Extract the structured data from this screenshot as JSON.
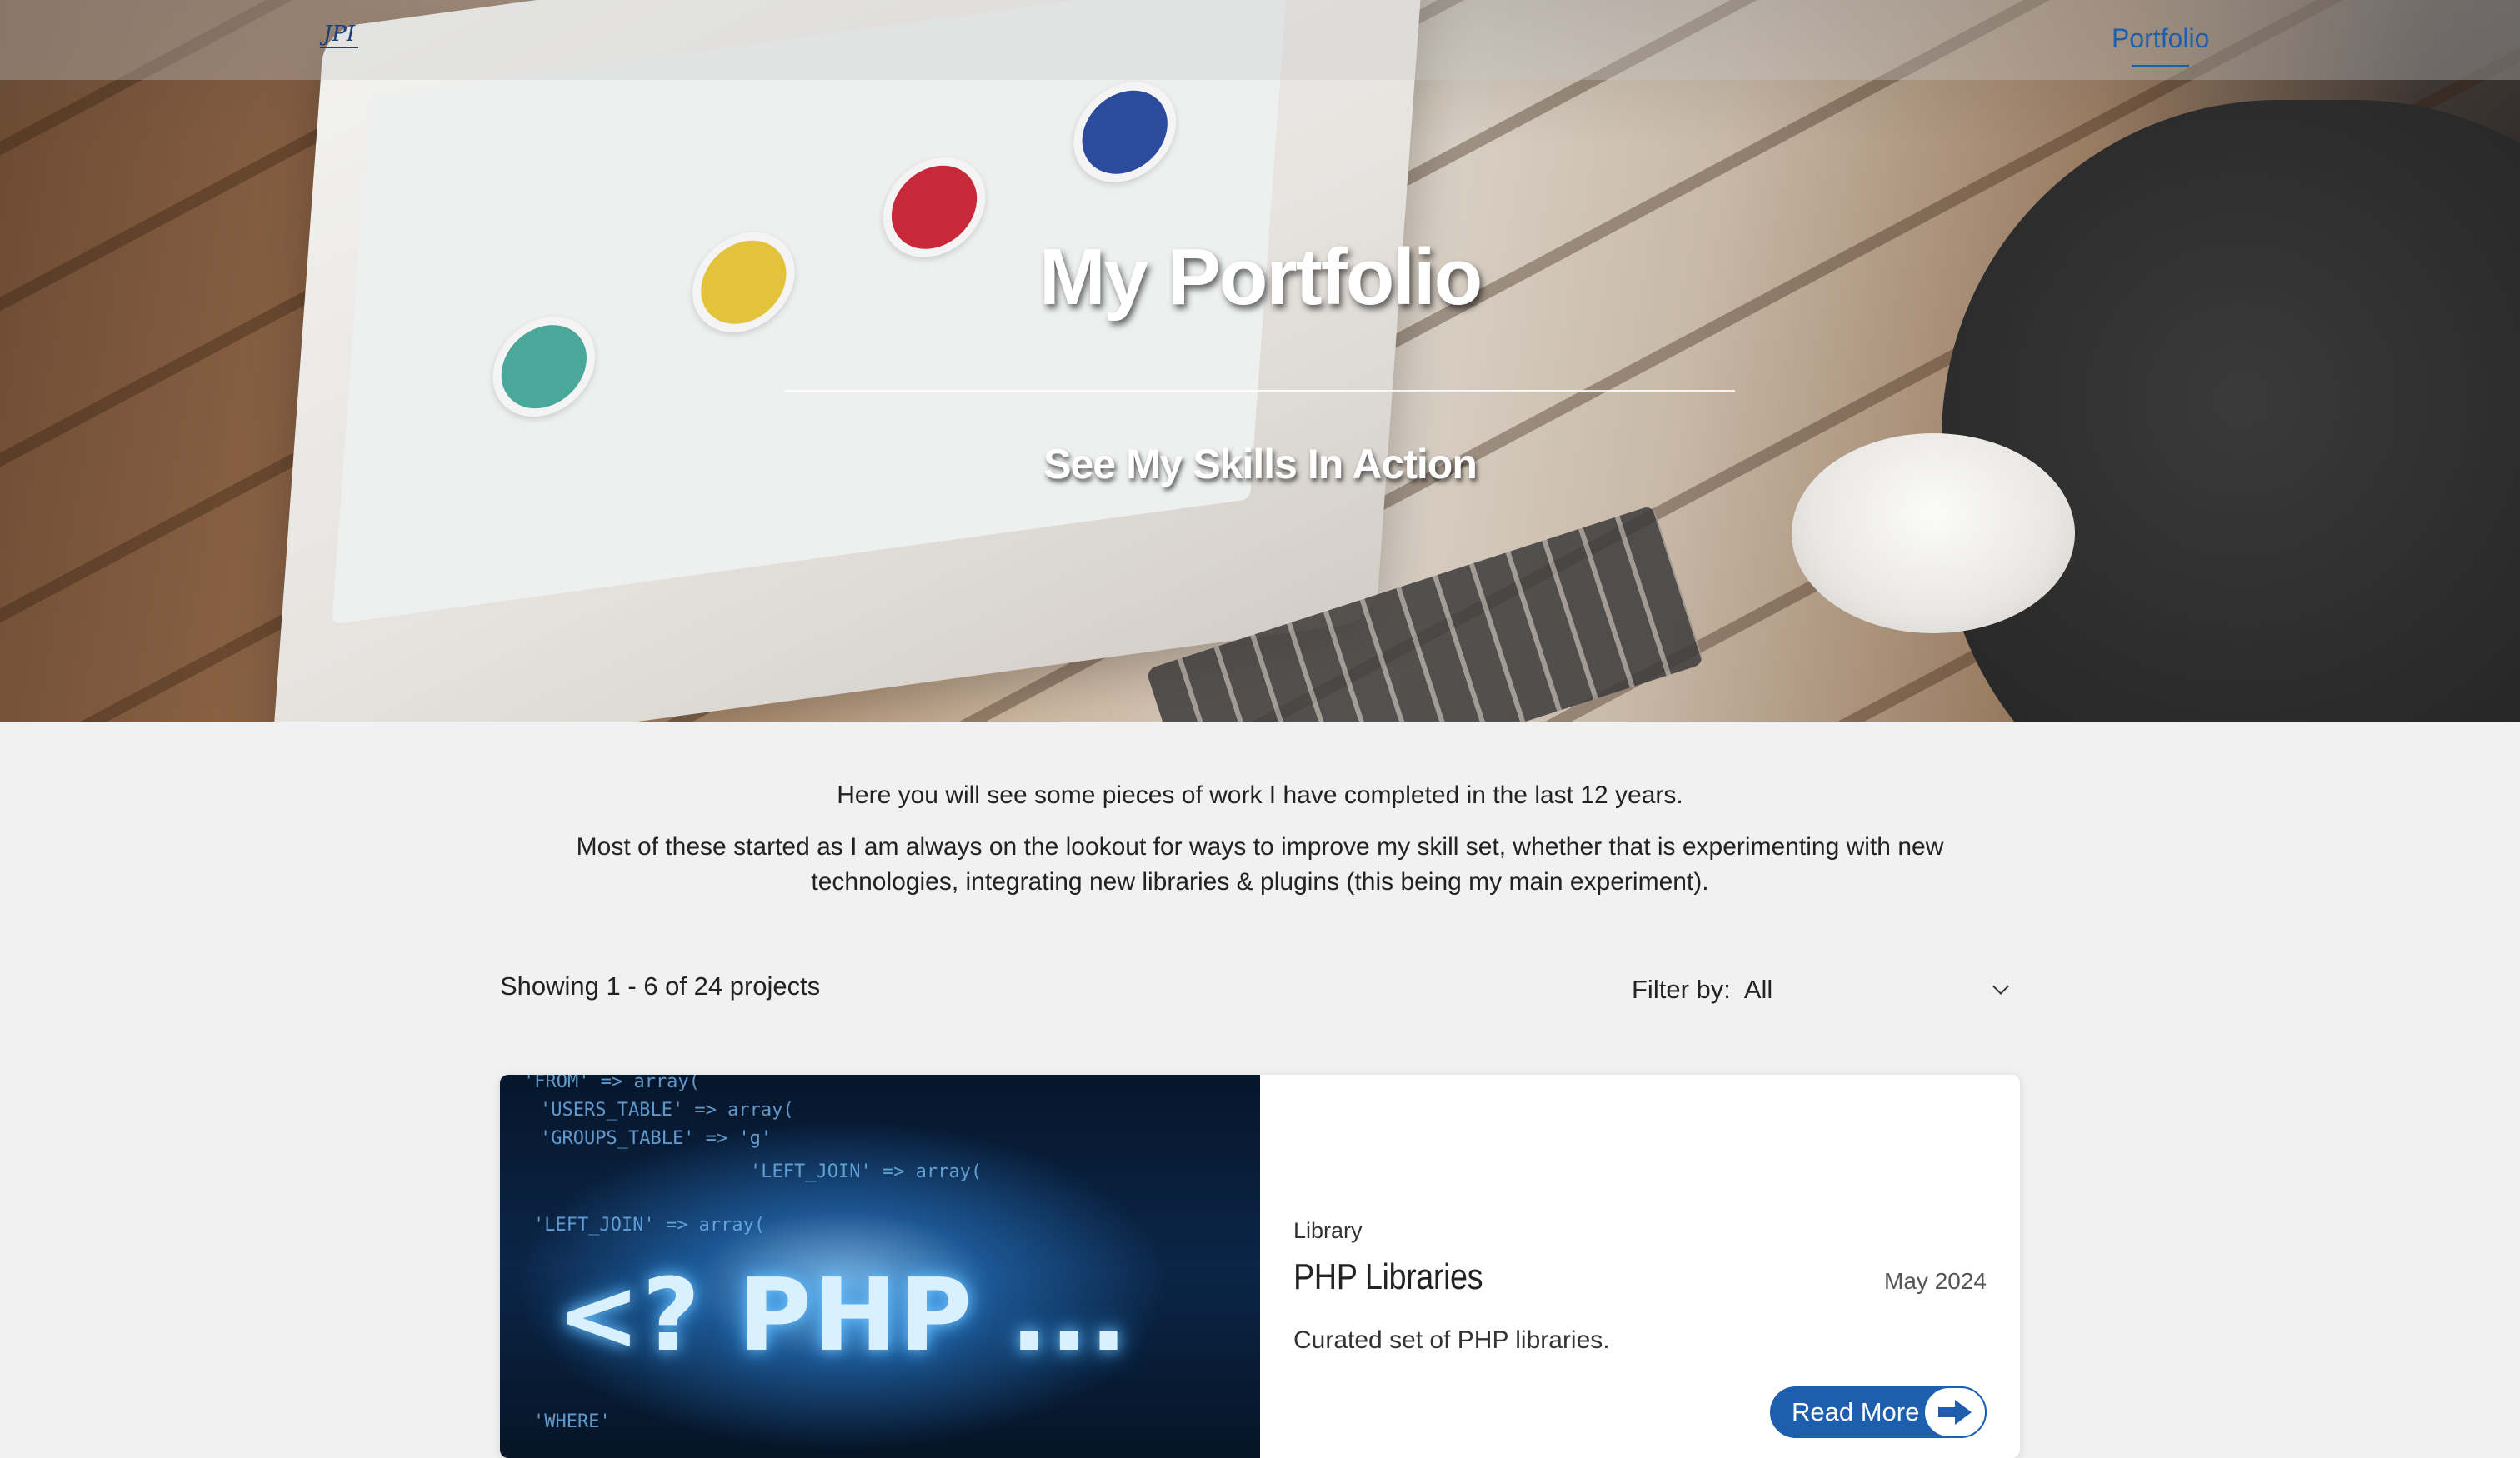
{
  "nav": {
    "logo_text": "JPI",
    "links": [
      {
        "label": "Portfolio"
      }
    ]
  },
  "hero": {
    "title": "My Portfolio",
    "subtitle": "See My Skills In Action"
  },
  "intro": {
    "line1": "Here you will see some pieces of work I have completed in the last 12 years.",
    "line2": "Most of these started as I am always on the lookout for ways to improve my skill set, whether that is experimenting with new technologies, integrating new libraries & plugins (this being my main experiment)."
  },
  "listing": {
    "showing": "Showing 1 - 6 of 24 projects",
    "filter_label": "Filter by:",
    "filter_value": "All"
  },
  "projects": [
    {
      "category": "Library",
      "title": "PHP Libraries",
      "date": "May 2024",
      "description": "Curated set of PHP libraries.",
      "cta": "Read More",
      "image": {
        "headline": "<? PHP ...",
        "code_lines": [
          "'FROM'  => array(",
          "'USERS_TABLE' => array(",
          "'GROUPS_TABLE' => 'g'",
          "'LEFT_JOIN' => array(",
          "'LEFT_JOIN' => array(",
          "'WHERE'"
        ]
      }
    }
  ],
  "colors": {
    "accent": "#1d5fae",
    "page_bg": "#f1f1f1",
    "card_bg": "#ffffff"
  }
}
